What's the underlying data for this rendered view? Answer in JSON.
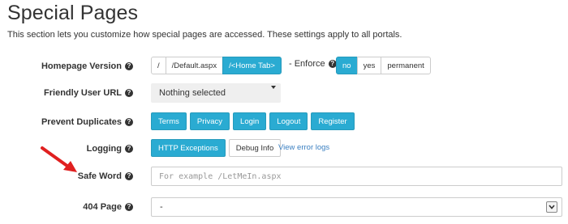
{
  "page": {
    "title": "Special Pages",
    "description": "This section lets you customize how special pages are accessed. These settings apply to all portals."
  },
  "help_glyph": "?",
  "homepage_version": {
    "label": "Homepage Version",
    "options": [
      "/",
      "/Default.aspx",
      "/<Home Tab>"
    ],
    "selected": "/<Home Tab>",
    "enforce_label": "- Enforce",
    "enforce_options": [
      "no",
      "yes",
      "permanent"
    ],
    "enforce_selected": "no"
  },
  "friendly_user_url": {
    "label": "Friendly User URL",
    "value": "Nothing selected"
  },
  "prevent_duplicates": {
    "label": "Prevent Duplicates",
    "buttons": [
      "Terms",
      "Privacy",
      "Login",
      "Logout",
      "Register"
    ]
  },
  "logging": {
    "label": "Logging",
    "options": [
      "HTTP Exceptions",
      "Debug Info"
    ],
    "selected": "HTTP Exceptions",
    "link": "View error logs"
  },
  "safe_word": {
    "label": "Safe Word",
    "value": "",
    "placeholder": "For example /LetMeIn.aspx"
  },
  "page_404": {
    "label": "404 Page",
    "value": "-"
  },
  "colors": {
    "accent": "#2aabd2",
    "arrow": "#e02020",
    "link": "#3a7fc1"
  }
}
